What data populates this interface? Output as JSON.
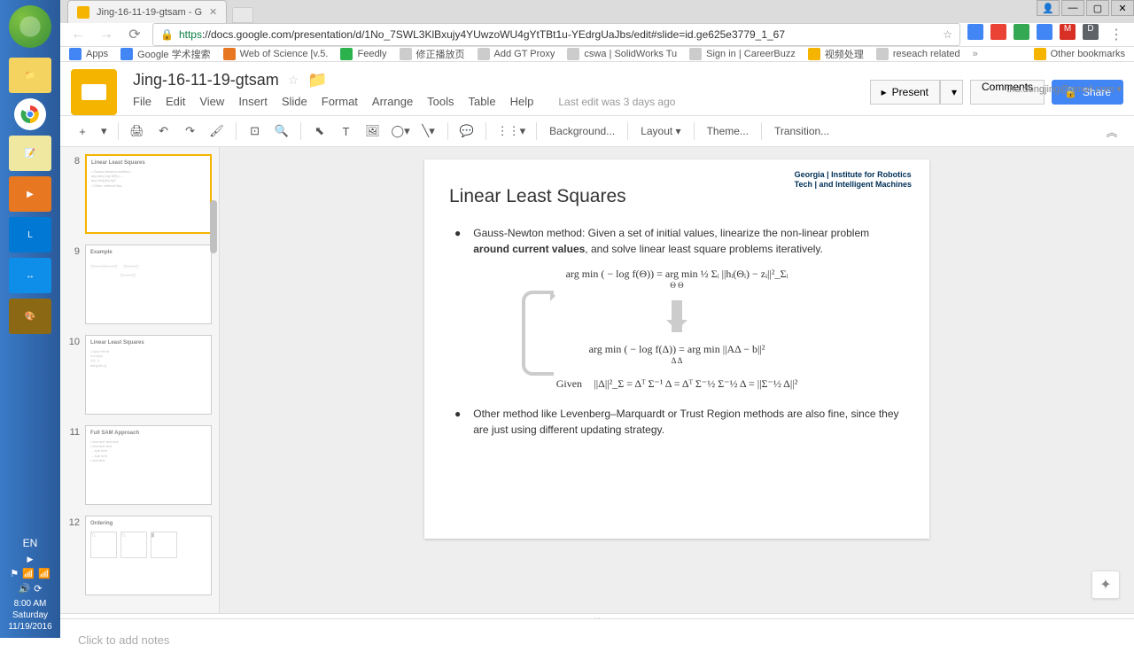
{
  "os": {
    "lang": "EN",
    "time": "8:00 AM",
    "day": "Saturday",
    "date": "11/19/2016"
  },
  "browser": {
    "tab_title": "Jing-16-11-19-gtsam - G",
    "url_proto": "https",
    "url_rest": "://docs.google.com/presentation/d/1No_7SWL3KlBxujy4YUwzoWU4gYtTBt1u-YEdrgUaJbs/edit#slide=id.ge625e3779_1_67",
    "apps_label": "Apps",
    "bookmarks": [
      "Google 学术搜索",
      "Web of Science [v.5.",
      "Feedly",
      "修正播放页",
      "Add GT Proxy",
      "cswa | SolidWorks Tu",
      "Sign in | CareerBuzz",
      "视频处理",
      "reseach related"
    ],
    "other_bookmarks": "Other bookmarks"
  },
  "app": {
    "doc_title": "Jing-16-11-19-gtsam",
    "user_email": "thu.dongjing@gmail.com",
    "menus": [
      "File",
      "Edit",
      "View",
      "Insert",
      "Slide",
      "Format",
      "Arrange",
      "Tools",
      "Table",
      "Help"
    ],
    "last_edit": "Last edit was 3 days ago",
    "present": "Present",
    "comments": "Comments",
    "share": "Share",
    "toolbar": {
      "background": "Background...",
      "layout": "Layout",
      "theme": "Theme...",
      "transition": "Transition..."
    },
    "notes_placeholder": "Click to add notes"
  },
  "thumbs": [
    {
      "num": "8",
      "title": "Linear Least Squares",
      "active": true
    },
    {
      "num": "9",
      "title": "Example",
      "active": false
    },
    {
      "num": "10",
      "title": "Linear Least Squares",
      "active": false
    },
    {
      "num": "11",
      "title": "Full SAM Approach",
      "active": false
    },
    {
      "num": "12",
      "title": "Ordering",
      "active": false
    }
  ],
  "slide": {
    "title": "Linear Least Squares",
    "logo1": "Georgia | Institute for Robotics",
    "logo2": "Tech | and Intelligent Machines",
    "bullet1_pre": "Gauss-Newton method: Given a set of initial values, linearize the non-linear problem ",
    "bullet1_bold": "around current values",
    "bullet1_post": ", and solve linear least square problems iteratively.",
    "eq1": "arg min ( − log f(Θ)) = arg min ½ Σᵢ ||hᵢ(Θᵢ) − zᵢ||²_Σᵢ",
    "eq1_sub": "Θ                                    Θ",
    "eq2": "arg min ( − log f(Δ)) = arg min ||AΔ − b||²",
    "eq2_sub": "Δ                                  Δ",
    "eq3_label": "Given",
    "eq3": "||Δ||²_Σ = Δᵀ Σ⁻¹ Δ = Δᵀ Σ⁻½ Σ⁻½ Δ = ||Σ⁻½ Δ||²",
    "bullet2": "Other method like Levenberg–Marquardt or Trust Region methods are also fine, since they are just using different updating strategy."
  }
}
